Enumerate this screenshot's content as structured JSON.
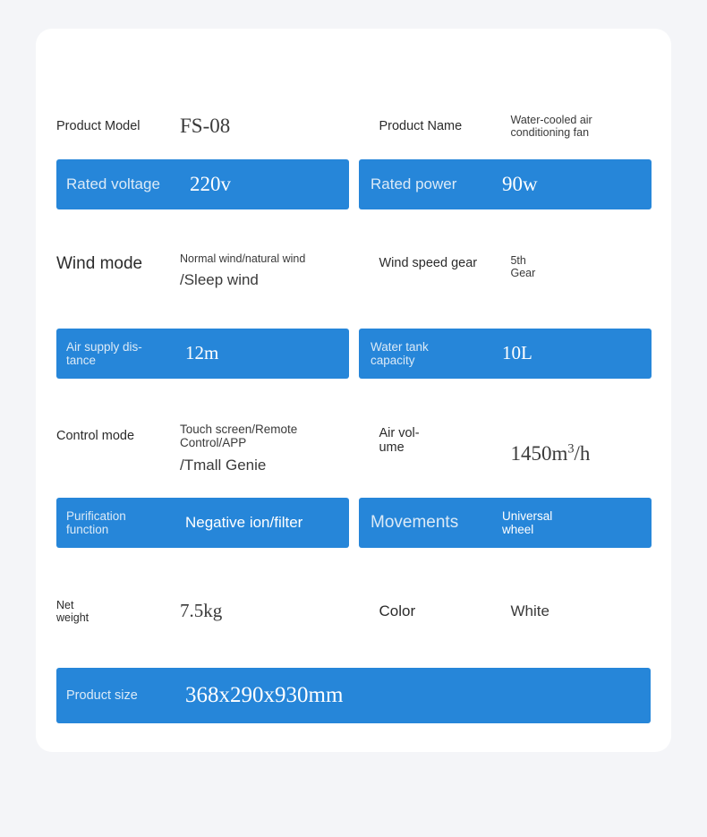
{
  "card": {
    "background": "#ffffff",
    "page_background": "#f4f5f8",
    "accent": "#2686d9",
    "accent_label_color": "#dbeaf7"
  },
  "rows": [
    {
      "highlight": false,
      "left": {
        "label": "Product Model",
        "value": "FS-08"
      },
      "right": {
        "label": "Product Name",
        "value": "Water-cooled air\nconditioning fan"
      }
    },
    {
      "highlight": true,
      "left": {
        "label": "Rated voltage",
        "value": "220v"
      },
      "right": {
        "label": "Rated power",
        "value": "90w"
      }
    },
    {
      "highlight": false,
      "left": {
        "label": "Wind mode",
        "value_line1": "Normal wind/natural wind",
        "value_line2": "/Sleep wind"
      },
      "right": {
        "label": "Wind speed gear",
        "value": "5th\nGear"
      }
    },
    {
      "highlight": true,
      "left": {
        "label": "Air supply dis-\ntance",
        "value": "12m"
      },
      "right": {
        "label": "Water tank\ncapacity",
        "value": "10L"
      }
    },
    {
      "highlight": false,
      "left": {
        "label": "Control mode",
        "value_line1": "Touch screen/Remote\nControl/APP",
        "value_line2": "/Tmall Genie"
      },
      "right": {
        "label": "Air vol-\nume",
        "value_prefix": "1450m",
        "value_sup": "3",
        "value_suffix": "/h"
      }
    },
    {
      "highlight": true,
      "left": {
        "label": "Purification\nfunction",
        "value": "Negative ion/filter"
      },
      "right": {
        "label": "Movements",
        "value": "Universal\nwheel"
      }
    },
    {
      "highlight": false,
      "left": {
        "label": "Net\nweight",
        "value": "7.5kg"
      },
      "right": {
        "label": "Color",
        "value": "White"
      }
    },
    {
      "highlight": true,
      "full": {
        "label": "Product size",
        "value": "368x290x930mm"
      }
    }
  ]
}
